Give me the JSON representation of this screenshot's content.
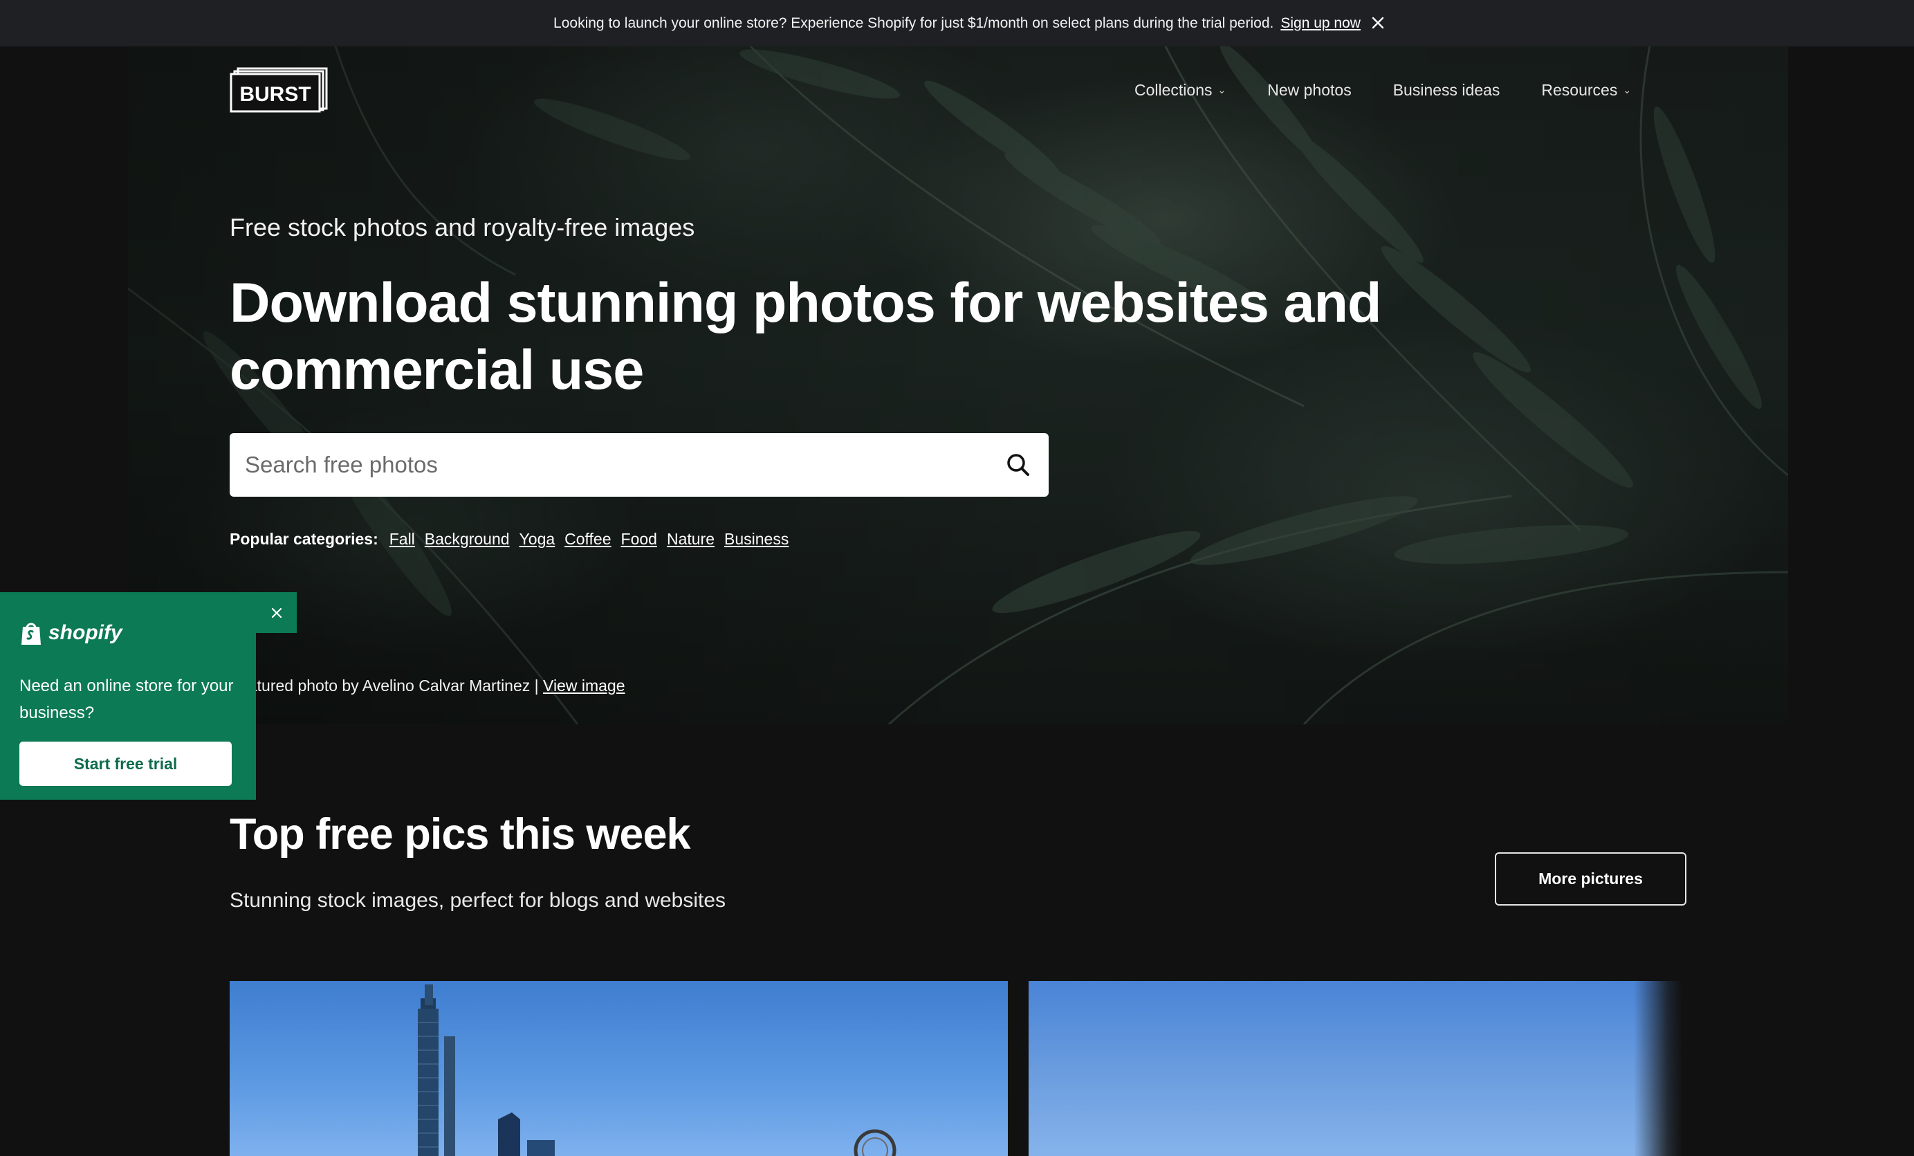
{
  "banner": {
    "text": "Looking to launch your online store? Experience Shopify for just $1/month on select plans during the trial period.",
    "link_label": "Sign up now",
    "close_icon": "close-icon"
  },
  "header": {
    "logo_text": "BURST",
    "nav": [
      {
        "label": "Collections",
        "has_dropdown": true
      },
      {
        "label": "New photos",
        "has_dropdown": false
      },
      {
        "label": "Business ideas",
        "has_dropdown": false
      },
      {
        "label": "Resources",
        "has_dropdown": true
      }
    ]
  },
  "hero": {
    "subtitle": "Free stock photos and royalty-free images",
    "title": "Download stunning photos for websites and commercial use",
    "search_placeholder": "Search free photos",
    "categories_label": "Popular categories:",
    "categories": [
      "Fall",
      "Background",
      "Yoga",
      "Coffee",
      "Food",
      "Nature",
      "Business"
    ],
    "credit_text": "Featured photo by Avelino Calvar Martinez |",
    "credit_link": "View image"
  },
  "shopify_popup": {
    "logo_text": "shopify",
    "message": "Need an online store for your business?",
    "button_label": "Start free trial",
    "accent_color": "#0c7a55"
  },
  "top_pics": {
    "title": "Top free pics this week",
    "subtitle": "Stunning stock images, perfect for blogs and websites",
    "more_button": "More pictures"
  },
  "colors": {
    "page_background": "#111111",
    "banner_background": "#1f2023",
    "shopify_green": "#0c7a55"
  }
}
